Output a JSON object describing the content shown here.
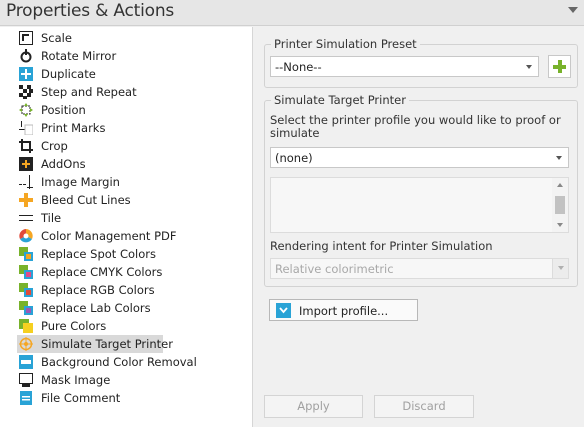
{
  "panel": {
    "title": "Properties & Actions"
  },
  "actions": [
    {
      "label": "Scale",
      "icon": "scale-icon"
    },
    {
      "label": "Rotate Mirror",
      "icon": "rotate-mirror-icon"
    },
    {
      "label": "Duplicate",
      "icon": "duplicate-icon"
    },
    {
      "label": "Step and Repeat",
      "icon": "step-and-repeat-icon"
    },
    {
      "label": "Position",
      "icon": "position-icon"
    },
    {
      "label": "Print Marks",
      "icon": "print-marks-icon"
    },
    {
      "label": "Crop",
      "icon": "crop-icon"
    },
    {
      "label": "AddOns",
      "icon": "addons-icon"
    },
    {
      "label": "Image Margin",
      "icon": "image-margin-icon"
    },
    {
      "label": "Bleed Cut Lines",
      "icon": "bleed-cut-lines-icon"
    },
    {
      "label": "Tile",
      "icon": "tile-icon"
    },
    {
      "label": "Color Management PDF",
      "icon": "color-management-icon"
    },
    {
      "label": "Replace Spot Colors",
      "icon": "replace-spot-colors-icon"
    },
    {
      "label": "Replace CMYK Colors",
      "icon": "replace-cmyk-colors-icon"
    },
    {
      "label": "Replace RGB Colors",
      "icon": "replace-rgb-colors-icon"
    },
    {
      "label": "Replace Lab Colors",
      "icon": "replace-lab-colors-icon"
    },
    {
      "label": "Pure Colors",
      "icon": "pure-colors-icon"
    },
    {
      "label": "Simulate Target Printer",
      "icon": "simulate-target-printer-icon",
      "selected": true
    },
    {
      "label": "Background Color Removal",
      "icon": "background-color-removal-icon"
    },
    {
      "label": "Mask Image",
      "icon": "mask-image-icon"
    },
    {
      "label": "File Comment",
      "icon": "file-comment-icon"
    }
  ],
  "preset": {
    "legend": "Printer Simulation Preset",
    "value": "--None--"
  },
  "simulate": {
    "legend": "Simulate Target Printer",
    "description": "Select the printer profile you would like to proof or simulate",
    "profile_value": "(none)",
    "intent_label": "Rendering intent for Printer Simulation",
    "intent_value": "Relative colorimetric"
  },
  "buttons": {
    "import_profile": "Import profile...",
    "apply": "Apply",
    "discard": "Discard"
  },
  "colors": {
    "accent_green": "#78b22b",
    "accent_blue": "#29a3d6",
    "selection": "#d9d9d9"
  }
}
